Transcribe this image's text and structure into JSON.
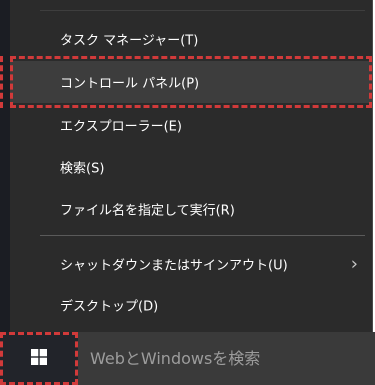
{
  "context_menu": {
    "items": [
      {
        "label": "タスク マネージャー(T)"
      },
      {
        "label": "コントロール パネル(P)"
      },
      {
        "label": "エクスプローラー(E)"
      },
      {
        "label": "検索(S)"
      },
      {
        "label": "ファイル名を指定して実行(R)"
      },
      {
        "label": "シャットダウンまたはサインアウト(U)"
      },
      {
        "label": "デスクトップ(D)"
      }
    ]
  },
  "taskbar": {
    "search_placeholder": "WebとWindowsを検索",
    "start_icon": "windows-logo-icon"
  },
  "colors": {
    "menu_background": "#2b2b2b",
    "menu_selected": "#3d3d3d",
    "annotation_red": "#d13a3a",
    "taskbar_background": "#111318",
    "search_background": "#3a3a3a"
  }
}
